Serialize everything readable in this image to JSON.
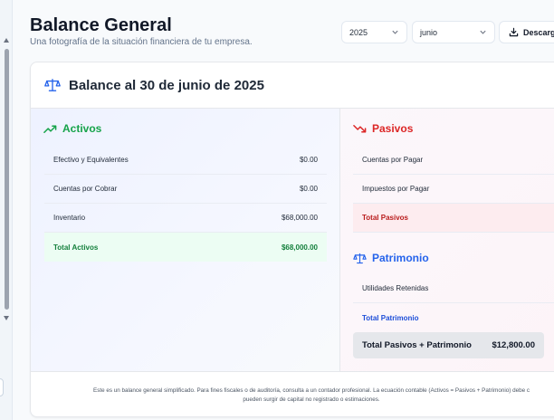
{
  "header": {
    "title": "Balance General",
    "subtitle": "Una fotografía de la situación financiera de tu empresa.",
    "year": "2025",
    "month": "junio",
    "download_label": "Descarga"
  },
  "card": {
    "title": "Balance al 30 de junio de 2025"
  },
  "activos": {
    "heading": "Activos",
    "rows": [
      {
        "label": "Efectivo y Equivalentes",
        "value": "$0.00"
      },
      {
        "label": "Cuentas por Cobrar",
        "value": "$0.00"
      },
      {
        "label": "Inventario",
        "value": "$68,000.00"
      }
    ],
    "total": {
      "label": "Total Activos",
      "value": "$68,000.00"
    }
  },
  "pasivos": {
    "heading": "Pasivos",
    "rows": [
      {
        "label": "Cuentas por Pagar"
      },
      {
        "label": "Impuestos por Pagar"
      }
    ],
    "total": {
      "label": "Total Pasivos"
    }
  },
  "patrimonio": {
    "heading": "Patrimonio",
    "rows": [
      {
        "label": "Utilidades Retenidas"
      }
    ],
    "total": {
      "label": "Total Patrimonio"
    }
  },
  "grand_total": {
    "label": "Total Pasivos + Patrimonio",
    "value": "$12,800.00"
  },
  "footer": {
    "line1": "Este es un balance general simplificado. Para fines fiscales o de auditoría, consulta a un contador profesional. La ecuación contable (Activos = Pasivos + Patrimonio) debe c",
    "line2": "pueden surgir de capital no registrado o estimaciones."
  },
  "colors": {
    "activos": "#16a34a",
    "pasivos": "#dc2626",
    "patrimonio": "#2563eb"
  }
}
